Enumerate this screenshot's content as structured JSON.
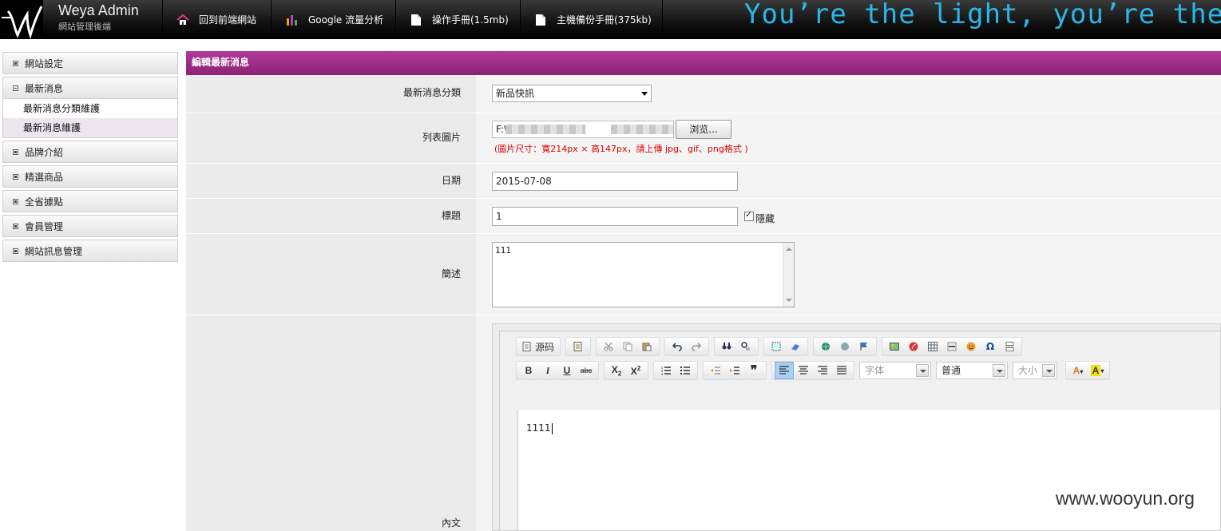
{
  "header": {
    "title": "Weya Admin",
    "subtitle": "網站管理後端",
    "nav": [
      {
        "label": "回到前端網站",
        "icon": "home-icon"
      },
      {
        "label": "Google 流量分析",
        "icon": "bar-chart-icon"
      },
      {
        "label": "操作手冊(1.5mb)",
        "icon": "document-icon"
      },
      {
        "label": "主機備份手冊(375kb)",
        "icon": "document-icon"
      }
    ],
    "marquee": "You’re the light, you’re the"
  },
  "sidebar": {
    "sections": [
      {
        "label": "網站設定",
        "expanded": false
      },
      {
        "label": "最新消息",
        "expanded": true
      },
      {
        "label": "品牌介紹",
        "expanded": false
      },
      {
        "label": "精選商品",
        "expanded": false
      },
      {
        "label": "全省據點",
        "expanded": false
      },
      {
        "label": "會員管理",
        "expanded": false
      },
      {
        "label": "網站訊息管理",
        "expanded": false
      }
    ],
    "news_items": [
      {
        "label": "最新消息分類維護"
      },
      {
        "label": "最新消息維護"
      }
    ]
  },
  "form": {
    "panel_title": "編輯最新消息",
    "category_label": "最新消息分類",
    "category_value": "新品快訊",
    "image_label": "列表圖片",
    "image_path_prefix": "F:\\",
    "browse_label": "浏览...",
    "image_hint": "(圖片尺寸：寬214px × 高147px，請上傳 jpg、gif、png格式 )",
    "date_label": "日期",
    "date_value": "2015-07-08",
    "title_label": "標題",
    "title_value": "1",
    "hidden_label": "隱藏",
    "hidden_checked": true,
    "summary_label": "簡述",
    "summary_value": "111",
    "content_label": "內文"
  },
  "editor": {
    "source_label": "源码",
    "font_placeholder": "字体",
    "format_value": "普通",
    "size_placeholder": "大小",
    "content": "1111"
  },
  "watermark": "www.wooyun.org",
  "colors": {
    "panel_title": "#9a2b83",
    "marquee": "#29b6e8",
    "hint": "#dd0000"
  }
}
